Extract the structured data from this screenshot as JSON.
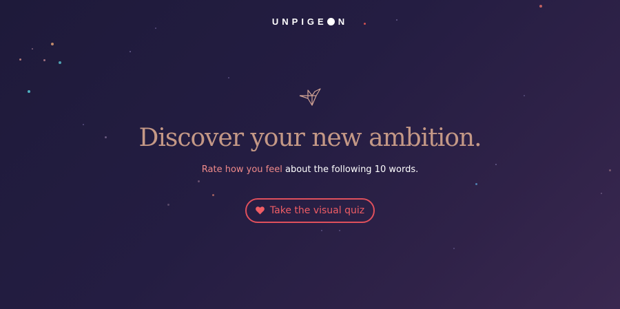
{
  "brand": {
    "logo_prefix": "UNPIGE",
    "logo_suffix": "N"
  },
  "hero": {
    "headline": "Discover your new ambition.",
    "sub_accent": "Rate how you feel",
    "sub_rest": " about the following 10 words."
  },
  "cta": {
    "label": "Take the visual quiz",
    "icon": "heart-icon"
  },
  "colors": {
    "background_start": "#1e1a3a",
    "background_end": "#3a2850",
    "headline": "#c49886",
    "accent_text": "#f08a8a",
    "cta": "#e0505c"
  }
}
